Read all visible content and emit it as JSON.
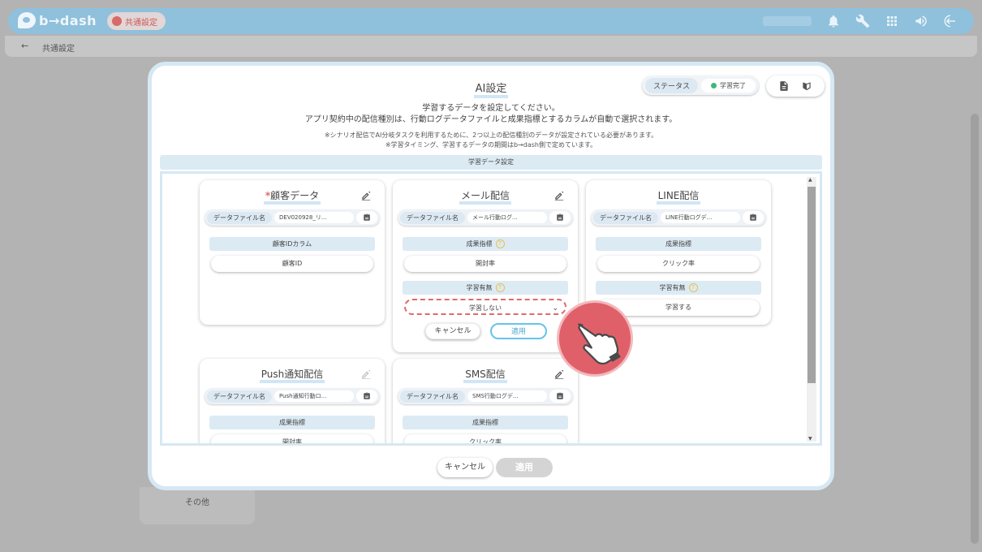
{
  "app": {
    "logo_text": "b→dash",
    "badge": "共通設定",
    "breadcrumb": "共通設定",
    "background_menu_item": "その他"
  },
  "modal": {
    "title": "AI設定",
    "status_label": "ステータス",
    "status_value": "学習完了",
    "description_line1": "学習するデータを設定してください。",
    "description_line2": "アプリ契約中の配信種別は、行動ログデータファイルと成果指標とするカラムが自動で選択されます。",
    "note_line1": "※シナリオ配信でAI分岐タスクを利用するために、2つ以上の配信種別のデータが設定されている必要があります。",
    "note_line2": "※学習タイミング、学習するデータの期間はb→dash側で定めています。",
    "section_title": "学習データ設定",
    "cancel_button": "キャンセル",
    "apply_button": "適用"
  },
  "cards": {
    "customer": {
      "required_mark": "*",
      "title": "顧客データ",
      "file_label": "データファイル名",
      "file_value": "DEV020928_リ...",
      "field1_head": "顧客IDカラム",
      "field1_value": "顧客ID"
    },
    "mail": {
      "title": "メール配信",
      "file_label": "データファイル名",
      "file_value": "メール行動ログ...",
      "field1_head": "成果指標",
      "field1_value": "開封率",
      "field2_head": "学習有無",
      "field2_value": "学習しない",
      "cancel": "キャンセル",
      "apply": "適用"
    },
    "line": {
      "title": "LINE配信",
      "file_label": "データファイル名",
      "file_value": "LINE行動ログデ...",
      "field1_head": "成果指標",
      "field1_value": "クリック率",
      "field2_head": "学習有無",
      "field2_value": "学習する"
    },
    "push": {
      "title": "Push通知配信",
      "file_label": "データファイル名",
      "file_value": "Push通知行動ロ...",
      "field1_head": "成果指標",
      "field1_value": "開封率"
    },
    "sms": {
      "title": "SMS配信",
      "file_label": "データファイル名",
      "file_value": "SMS行動ログデ...",
      "field1_head": "成果指標",
      "field1_value": "クリック率"
    }
  },
  "colors": {
    "header": "#8fc0dc",
    "accent": "#67c4e6",
    "highlight": "#e06a6a",
    "status_ok": "#3fb67e"
  }
}
